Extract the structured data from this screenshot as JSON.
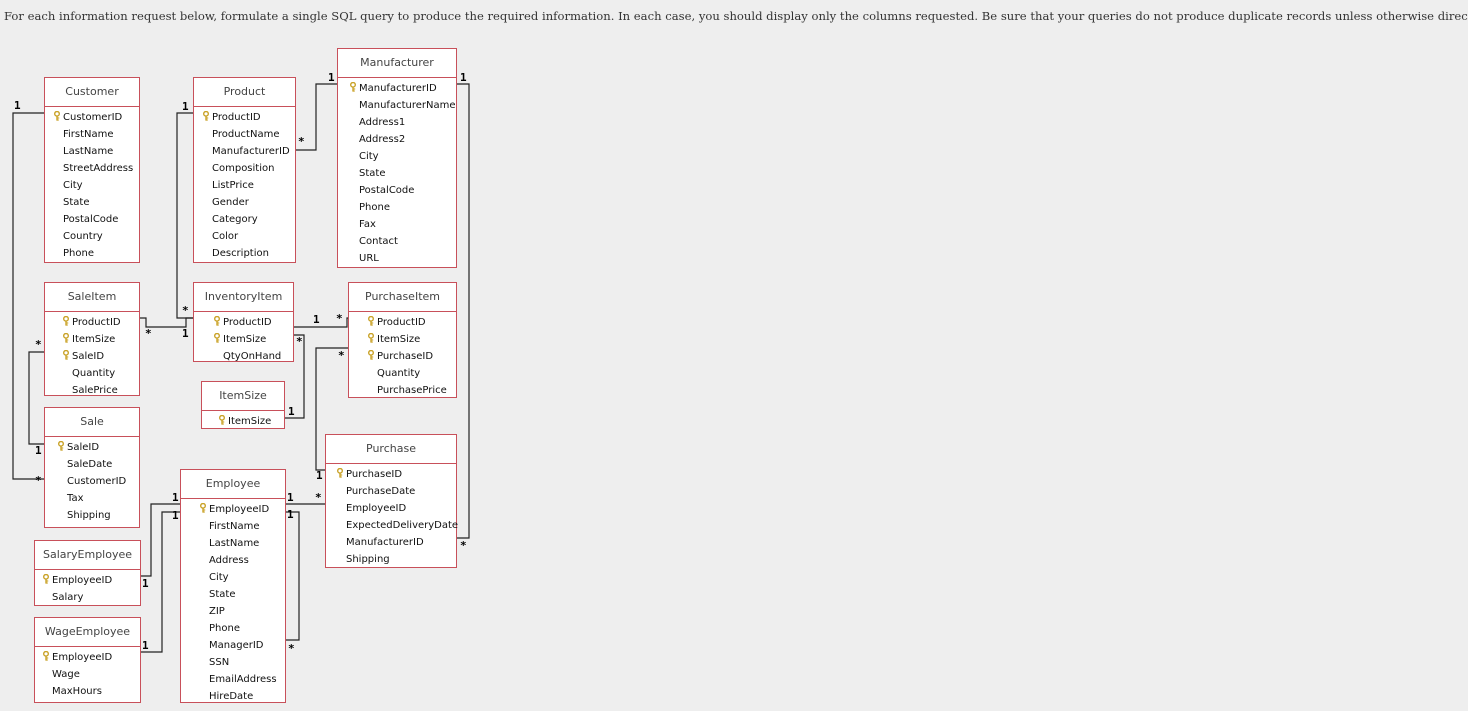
{
  "instructions": "For each information request below, formulate a single SQL query to produce the required information.  In each case, you should display only the columns requested.  Be sure that your queries do not produce duplicate records unless otherwise directed.",
  "tables": {
    "customer": {
      "title": "Customer",
      "fields": [
        {
          "name": "CustomerID",
          "key": true
        },
        {
          "name": "FirstName"
        },
        {
          "name": "LastName"
        },
        {
          "name": "StreetAddress"
        },
        {
          "name": "City"
        },
        {
          "name": "State"
        },
        {
          "name": "PostalCode"
        },
        {
          "name": "Country"
        },
        {
          "name": "Phone"
        }
      ]
    },
    "product": {
      "title": "Product",
      "fields": [
        {
          "name": "ProductID",
          "key": true
        },
        {
          "name": "ProductName"
        },
        {
          "name": "ManufacturerID"
        },
        {
          "name": "Composition"
        },
        {
          "name": "ListPrice"
        },
        {
          "name": "Gender"
        },
        {
          "name": "Category"
        },
        {
          "name": "Color"
        },
        {
          "name": "Description"
        }
      ]
    },
    "manufacturer": {
      "title": "Manufacturer",
      "fields": [
        {
          "name": "ManufacturerID",
          "key": true
        },
        {
          "name": "ManufacturerName"
        },
        {
          "name": "Address1"
        },
        {
          "name": "Address2"
        },
        {
          "name": "City"
        },
        {
          "name": "State"
        },
        {
          "name": "PostalCode"
        },
        {
          "name": "Phone"
        },
        {
          "name": "Fax"
        },
        {
          "name": "Contact"
        },
        {
          "name": "URL"
        }
      ]
    },
    "saleitem": {
      "title": "SaleItem",
      "fields": [
        {
          "name": "ProductID",
          "key": true
        },
        {
          "name": "ItemSize",
          "key": true
        },
        {
          "name": "SaleID",
          "key": true
        },
        {
          "name": "Quantity"
        },
        {
          "name": "SalePrice"
        }
      ]
    },
    "inventoryitem": {
      "title": "InventoryItem",
      "fields": [
        {
          "name": "ProductID",
          "key": true
        },
        {
          "name": "ItemSize",
          "key": true
        },
        {
          "name": "QtyOnHand"
        }
      ]
    },
    "purchaseitem": {
      "title": "PurchaseItem",
      "fields": [
        {
          "name": "ProductID",
          "key": true
        },
        {
          "name": "ItemSize",
          "key": true
        },
        {
          "name": "PurchaseID",
          "key": true
        },
        {
          "name": "Quantity"
        },
        {
          "name": "PurchasePrice"
        }
      ]
    },
    "itemsize": {
      "title": "ItemSize",
      "fields": [
        {
          "name": "ItemSize",
          "key": true
        }
      ]
    },
    "sale": {
      "title": "Sale",
      "fields": [
        {
          "name": "SaleID",
          "key": true
        },
        {
          "name": "SaleDate"
        },
        {
          "name": "CustomerID"
        },
        {
          "name": "Tax"
        },
        {
          "name": "Shipping"
        }
      ]
    },
    "purchase": {
      "title": "Purchase",
      "fields": [
        {
          "name": "PurchaseID",
          "key": true
        },
        {
          "name": "PurchaseDate"
        },
        {
          "name": "EmployeeID"
        },
        {
          "name": "ExpectedDeliveryDate"
        },
        {
          "name": "ManufacturerID"
        },
        {
          "name": "Shipping"
        }
      ]
    },
    "employee": {
      "title": "Employee",
      "fields": [
        {
          "name": "EmployeeID",
          "key": true
        },
        {
          "name": "FirstName"
        },
        {
          "name": "LastName"
        },
        {
          "name": "Address"
        },
        {
          "name": "City"
        },
        {
          "name": "State"
        },
        {
          "name": "ZIP"
        },
        {
          "name": "Phone"
        },
        {
          "name": "ManagerID"
        },
        {
          "name": "SSN"
        },
        {
          "name": "EmailAddress"
        },
        {
          "name": "HireDate"
        }
      ]
    },
    "salaryemployee": {
      "title": "SalaryEmployee",
      "fields": [
        {
          "name": "EmployeeID",
          "key": true
        },
        {
          "name": "Salary"
        }
      ]
    },
    "wageemployee": {
      "title": "WageEmployee",
      "fields": [
        {
          "name": "EmployeeID",
          "key": true
        },
        {
          "name": "Wage"
        },
        {
          "name": "MaxHours"
        }
      ]
    }
  },
  "cardinality": {
    "one": "1",
    "many": "*"
  },
  "colors": {
    "border": "#c8505a",
    "line": "#222222",
    "key": "#c9a227",
    "background": "#eeeeee"
  }
}
